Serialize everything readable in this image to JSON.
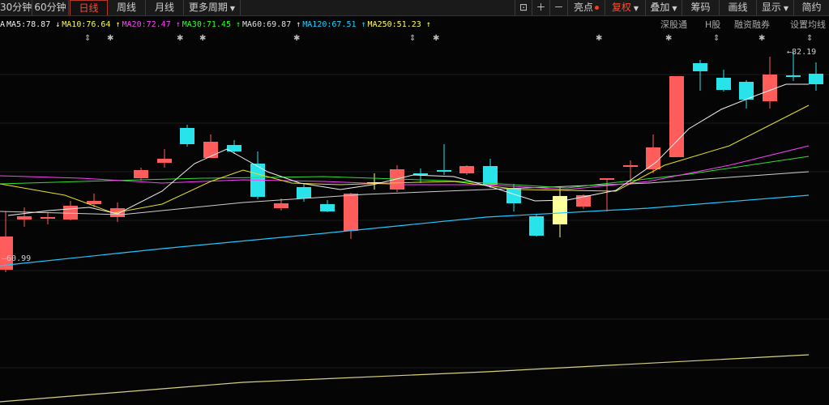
{
  "toolbar": {
    "items": [
      "30分钟",
      "60分钟",
      "日线",
      "周线",
      "月线",
      "更多周期"
    ],
    "active_index": 2,
    "right": [
      "亮点",
      "复权",
      "叠加",
      "筹码",
      "画线",
      "显示",
      "简约"
    ],
    "icons": [
      "lock-icon",
      "plus-icon",
      "minus-icon"
    ]
  },
  "ma_legend": [
    {
      "text": "MA5:78.87",
      "arrow": "↓",
      "color": "#f0f0f0"
    },
    {
      "text": "MA10:76.64",
      "arrow": "↑",
      "color": "#ffff30"
    },
    {
      "text": "MA20:72.47",
      "arrow": "↑",
      "color": "#ff40ff"
    },
    {
      "text": "MA30:71.45",
      "arrow": "↑",
      "color": "#30ff30"
    },
    {
      "text": "MA60:69.87",
      "arrow": "↑",
      "color": "#e0e0e0"
    },
    {
      "text": "MA120:67.51",
      "arrow": "↑",
      "color": "#20d0ff"
    },
    {
      "text": "MA250:51.23",
      "arrow": "↑",
      "color": "#ffff60"
    }
  ],
  "right_tools": [
    "深股通",
    "H股",
    "融资融券",
    "设置均线"
  ],
  "price_labels": {
    "high": "82.19",
    "low": "60.99"
  },
  "colors": {
    "up": "#ff5c5c",
    "down": "#28e4ea",
    "flat": "#ffff9a",
    "grid": "#1e1e1e"
  }
}
